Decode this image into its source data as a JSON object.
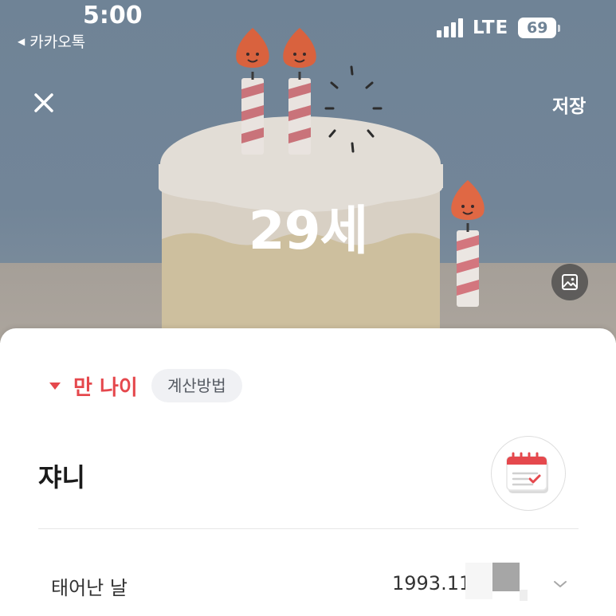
{
  "status_bar": {
    "time": "5:00",
    "back_app": "카카오톡",
    "network": "LTE",
    "battery": "69"
  },
  "header": {
    "save_label": "저장"
  },
  "hero": {
    "age": "29세"
  },
  "age_type": {
    "label": "만 나이",
    "calc_chip": "계산방법"
  },
  "profile": {
    "name": "쟈니"
  },
  "birth": {
    "label": "태어난 날",
    "value": "1993.11"
  },
  "icons": {
    "back": "back-triangle-icon",
    "close": "close-icon",
    "image": "image-icon",
    "calendar": "calendar-icon",
    "dropdown": "chevron-down-icon"
  },
  "colors": {
    "accent": "#e5484d",
    "hero_bg": "#6f8396"
  }
}
